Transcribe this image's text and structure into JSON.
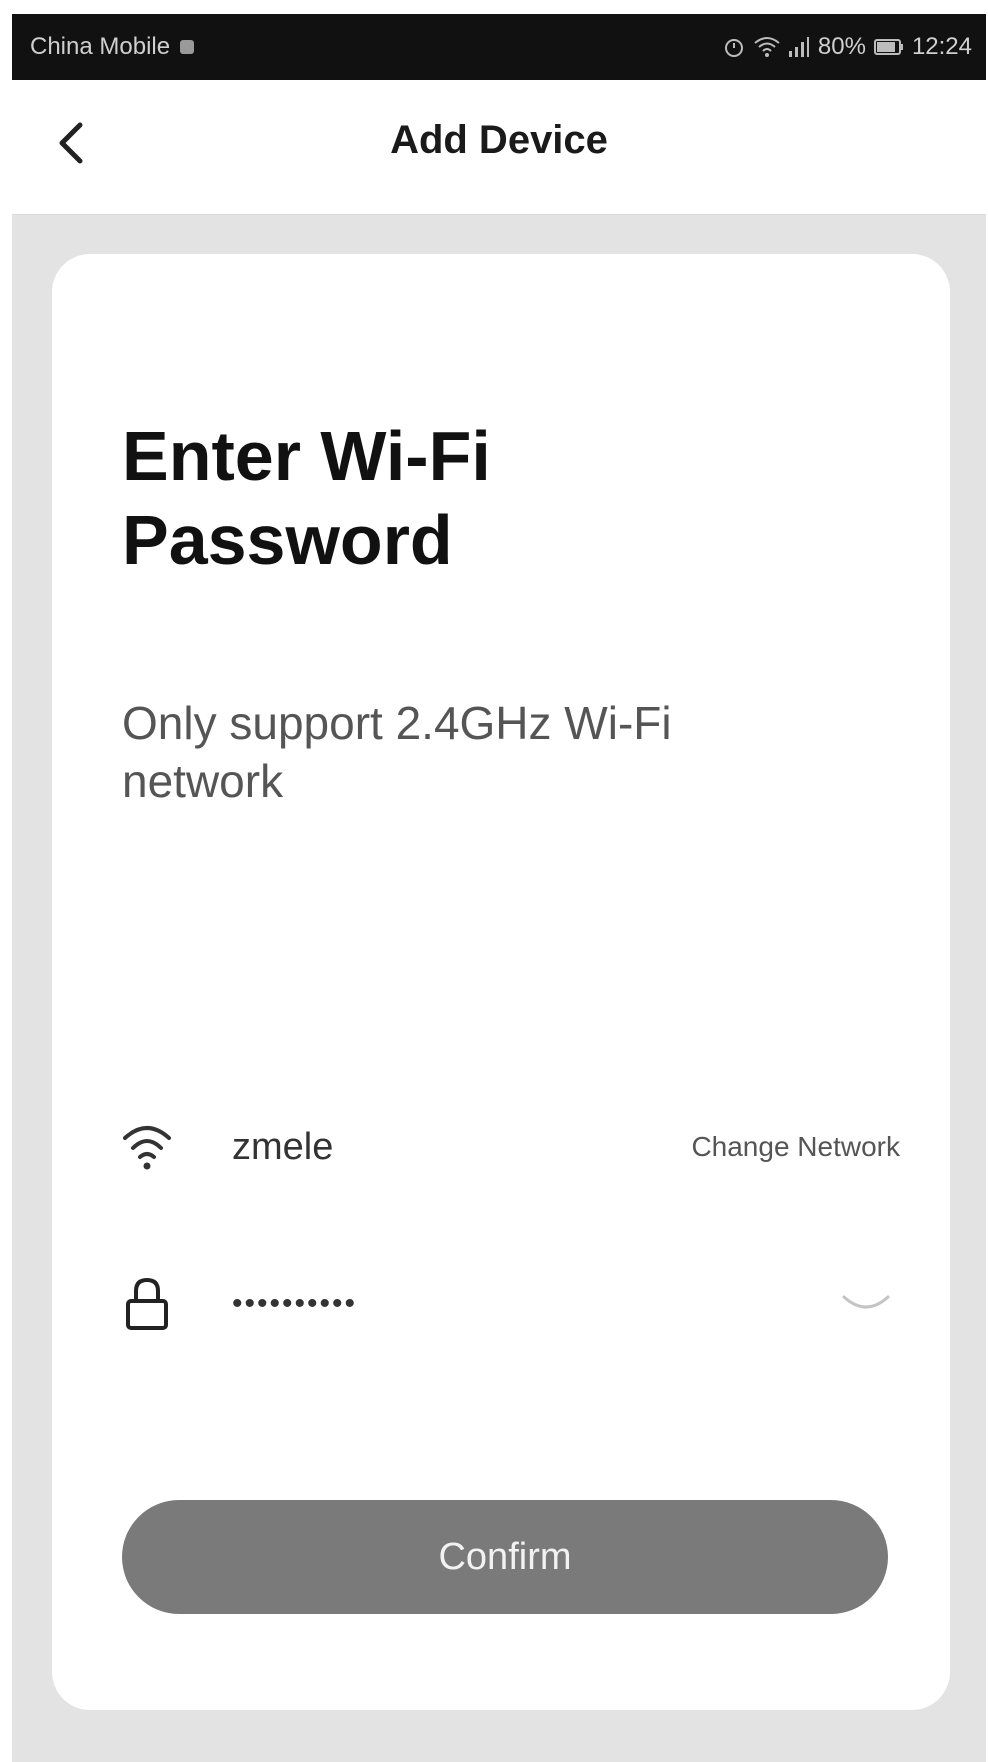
{
  "status_bar": {
    "carrier": "China Mobile",
    "battery": "80%",
    "time": "12:24"
  },
  "header": {
    "title": "Add Device"
  },
  "main": {
    "heading": "Enter Wi-Fi Password",
    "subtext": "Only support 2.4GHz Wi-Fi network",
    "network": {
      "name": "zmele",
      "change_label": "Change Network"
    },
    "password": {
      "value": "••••••••••"
    },
    "confirm_label": "Confirm"
  },
  "colors": {
    "confirm_button": "#7a7a7a",
    "page_background": "#e3e3e3"
  },
  "icons": {
    "back": "chevron-left-icon",
    "wifi": "wifi-icon",
    "lock": "lock-icon",
    "visibility": "eye-closed-icon"
  }
}
